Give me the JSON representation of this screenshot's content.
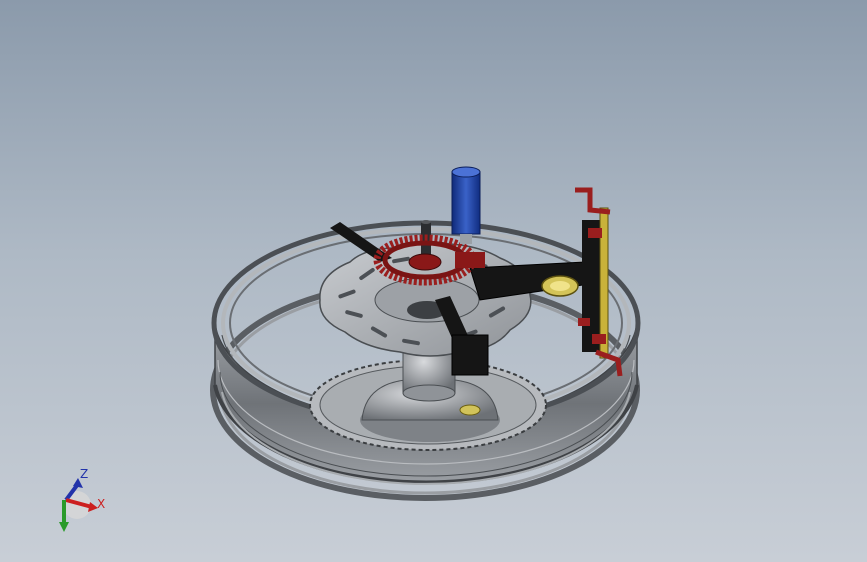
{
  "viewport": {
    "background_top": "#8b9aab",
    "background_bottom": "#c8ced6"
  },
  "model": {
    "components": [
      "wheel-rim-icon",
      "brake-disc-icon",
      "sprocket-icon",
      "hub-icon",
      "spindle-icon",
      "blue-cylinder-icon",
      "red-gear-icon",
      "black-arm-icon",
      "gauge-bracket-icon",
      "dial-indicator-icon"
    ],
    "colors": {
      "rim": "#8a8d91",
      "part_red": "#9a1e1e",
      "part_blue": "#1e3f9c",
      "arm_black": "#151515",
      "bracket_yellow": "#c9b23a"
    }
  },
  "triad": {
    "x_label": "X",
    "z_label": "Z",
    "x_color": "#cc1f1f",
    "z_color": "#2233aa",
    "y_color": "#2a9a2a"
  }
}
